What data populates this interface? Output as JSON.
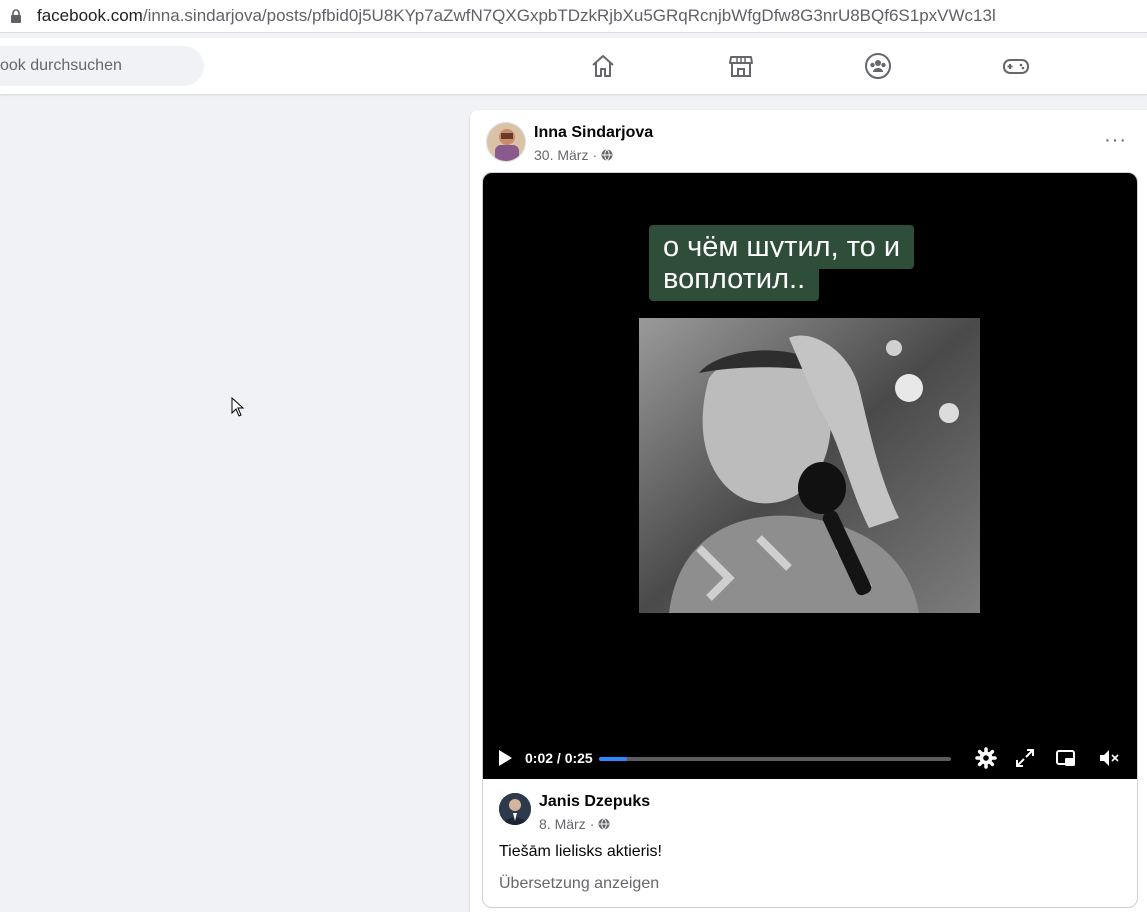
{
  "browser": {
    "url_domain": "facebook.com",
    "url_path": "/inna.sindarjova/posts/pfbid0j5U8KYp7aZwfN7QXGxpbTDzkRjbXu5GRqRcnjbWfgDfw8G3nrU8BQf6S1pxVWc13l"
  },
  "topnav": {
    "search_placeholder": "ook durchsuchen",
    "icons": [
      "home-icon",
      "marketplace-icon",
      "groups-icon",
      "gaming-icon"
    ]
  },
  "post": {
    "author": "Inna Sindarjova",
    "date": "30. März",
    "more_label": "···",
    "video": {
      "caption_line1": "о чём шутил, то и",
      "caption_line2": "воплотил..",
      "time": "0:02 / 0:25",
      "progress": 0.08
    },
    "shared_post": {
      "author": "Janis Dzepuks",
      "date": "8. März",
      "text": "Tiešām lielisks aktieris!",
      "translate_label": "Übersetzung anzeigen"
    }
  },
  "colors": {
    "accent": "#2d88ff",
    "caption_bg": "#2f4e3a",
    "page_bg": "#f0f2f5"
  }
}
